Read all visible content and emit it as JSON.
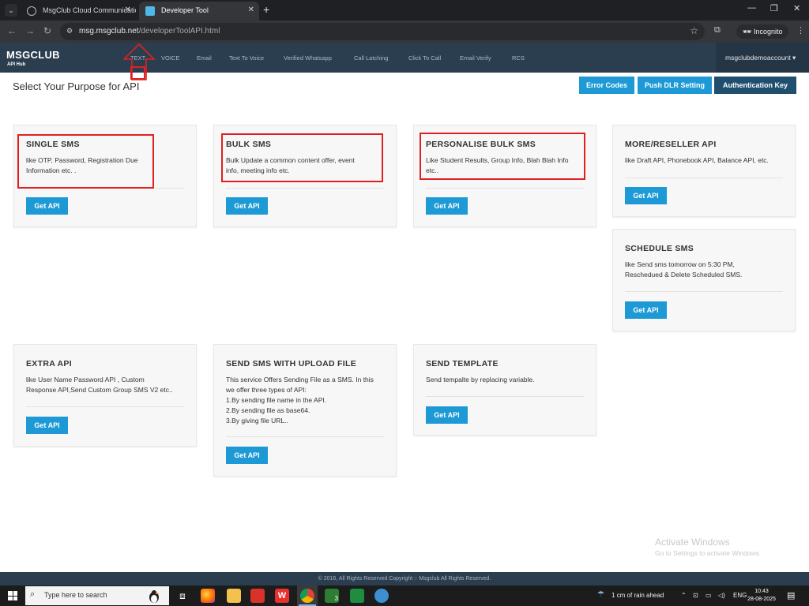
{
  "browser": {
    "tabs": [
      {
        "title": "MsgClub Cloud Communicatio",
        "active": false
      },
      {
        "title": "Developer Tool",
        "active": true
      }
    ],
    "url_host": "msg.msgclub.net",
    "url_path": "/developerToolAPI.html",
    "incognito_label": "Incognito"
  },
  "site": {
    "brand": "MSGCLUB",
    "brand_sub": "API Hub",
    "nav": [
      "TEXT",
      "VOICE",
      "Email",
      "Text To Voice",
      "Verified Whatsapp",
      "Call Latching",
      "Click To Call",
      "Email Verify",
      "RCS"
    ],
    "account": "msgclubdemoaccount"
  },
  "page": {
    "title": "Select Your Purpose for API",
    "buttons": {
      "error_codes": "Error Codes",
      "push_dlr": "Push DLR Setting",
      "auth_key": "Authentication Key"
    }
  },
  "cards": [
    {
      "title": "SINGLE SMS",
      "desc": [
        "like OTP, Password, Registration Due",
        "Information etc. ."
      ],
      "button": "Get API"
    },
    {
      "title": "BULK SMS",
      "desc": [
        "Bulk Update a common content offer, event",
        "info, meeting info etc."
      ],
      "button": "Get API"
    },
    {
      "title": "PERSONALISE BULK SMS",
      "desc": [
        "Like Student Results, Group Info, Blah Blah Info",
        "etc.."
      ],
      "button": "Get API"
    },
    {
      "title": "MORE/RESELLER API",
      "desc": [
        "like Draft API, Phonebook API, Balance API, etc."
      ],
      "button": "Get API"
    },
    {
      "title": "SCHEDULE SMS",
      "desc": [
        "like Send sms tomorrow on 5:30 PM,",
        "Reschedued & Delete Scheduled SMS."
      ],
      "button": "Get API"
    },
    {
      "title": "EXTRA API",
      "desc": [
        "like User Name Password API , Custom",
        "Response API,Send Custom Group SMS V2 etc.."
      ],
      "button": "Get API"
    },
    {
      "title": "SEND SMS WITH UPLOAD FILE",
      "desc": [
        "This service Offers Sending File as a SMS. In this",
        "we offer three types of API:",
        "1.By sending file name in the API.",
        "2.By sending file as base64.",
        "3.By giving file URL.."
      ],
      "button": "Get API"
    },
    {
      "title": "SEND TEMPLATE",
      "desc": [
        "Send tempalte by replacing variable."
      ],
      "button": "Get API"
    }
  ],
  "footer": "© 2016, All Rights Reserved Copyright :- Msgclub All Rights Reserved.",
  "watermark": {
    "line1": "Activate Windows",
    "line2": "Go to Settings to activate Windows."
  },
  "taskbar": {
    "search_placeholder": "Type here to search",
    "weather": "1 cm of rain ahead",
    "language": "ENG",
    "time": "10:43",
    "date": "28-08-2025",
    "chrome_badge": "3"
  },
  "colors": {
    "nav_bg": "#2b3e50",
    "get_api": "#1d9ad6",
    "annotation": "#e02020"
  }
}
